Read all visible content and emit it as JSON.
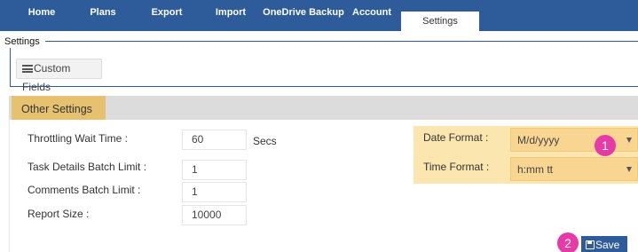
{
  "nav": {
    "tabs": [
      {
        "label": "Home"
      },
      {
        "label": "Plans"
      },
      {
        "label": "Export"
      },
      {
        "label": "Import"
      },
      {
        "label": "OneDrive Backup"
      },
      {
        "label": "Account"
      },
      {
        "label": "Settings",
        "active": true
      }
    ]
  },
  "settings_section": {
    "legend": "Settings",
    "custom_fields_button": "Custom Fields",
    "custom_fields_icon": "hamburger-menu-icon"
  },
  "other_settings": {
    "title": "Other Settings",
    "throttling": {
      "label": "Throttling Wait Time :",
      "value": "60",
      "unit": "Secs"
    },
    "task_details_batch": {
      "label": "Task Details Batch Limit :",
      "value": "1"
    },
    "comments_batch": {
      "label": "Comments Batch Limit :",
      "value": "1"
    },
    "report_size": {
      "label": "Report Size :",
      "value": "10000"
    },
    "date_format": {
      "label": "Date Format :",
      "value": "M/d/yyyy"
    },
    "time_format": {
      "label": "Time Format :",
      "value": "h:mm tt"
    }
  },
  "callouts": [
    "1",
    "2"
  ],
  "save_button": {
    "label": "Save",
    "icon": "floppy-disk-icon"
  },
  "colors": {
    "nav_bar": "#2e5c9a",
    "accent_gold": "#e6c270",
    "highlight": "#fbe6b0",
    "callout_badge": "#e63aa6"
  }
}
